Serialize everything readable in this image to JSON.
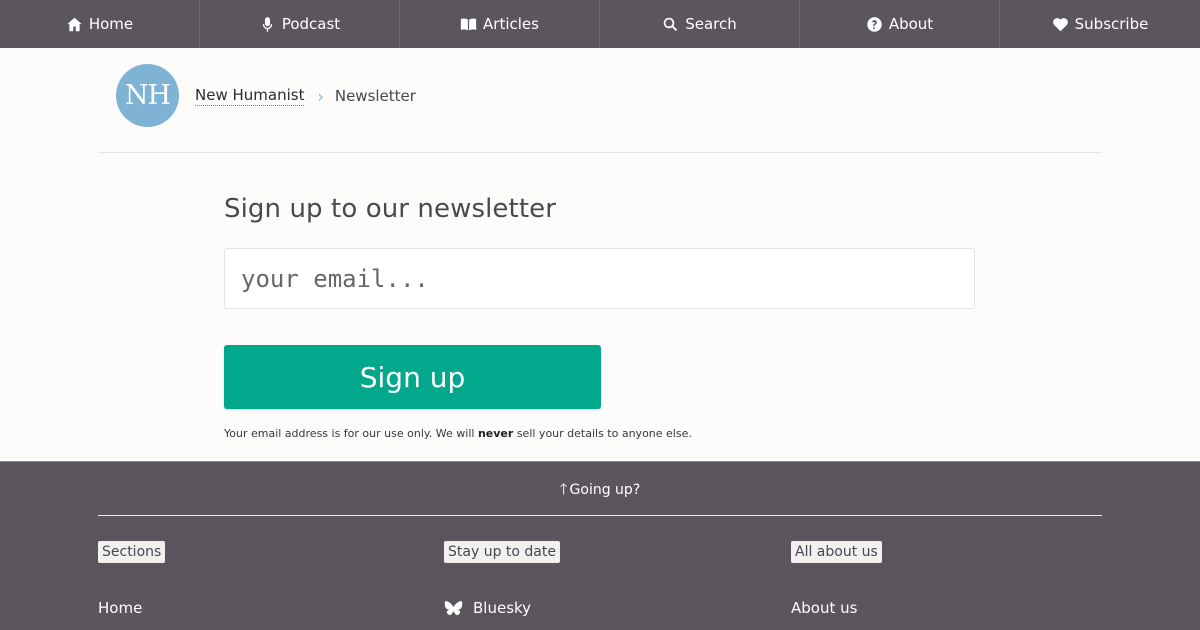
{
  "nav": [
    {
      "label": "Home",
      "icon": "home-icon"
    },
    {
      "label": "Podcast",
      "icon": "microphone-icon"
    },
    {
      "label": "Articles",
      "icon": "book-icon"
    },
    {
      "label": "Search",
      "icon": "search-icon"
    },
    {
      "label": "About",
      "icon": "question-circle-icon"
    },
    {
      "label": "Subscribe",
      "icon": "heart-icon"
    }
  ],
  "logo": {
    "text": "NH",
    "color": "#7fb3d6"
  },
  "breadcrumb": {
    "parent": "New Humanist",
    "separator": "›",
    "current": "Newsletter"
  },
  "signup": {
    "title": "Sign up to our newsletter",
    "email_placeholder": "your email...",
    "button_label": "Sign up",
    "button_color": "#02a88c",
    "privacy_before": "Your email address is for our use only. We will ",
    "privacy_bold": "never",
    "privacy_after": " sell your details to anyone else."
  },
  "footer": {
    "background": "#5b555d",
    "going_up_arrow": "🡑",
    "going_up_label": "Going up?",
    "columns": [
      {
        "heading": "Sections",
        "first_link": "Home"
      },
      {
        "heading": "Stay up to date",
        "first_link": "Bluesky",
        "first_link_icon": "butterfly-icon"
      },
      {
        "heading": "All about us",
        "first_link": "About us"
      }
    ]
  }
}
